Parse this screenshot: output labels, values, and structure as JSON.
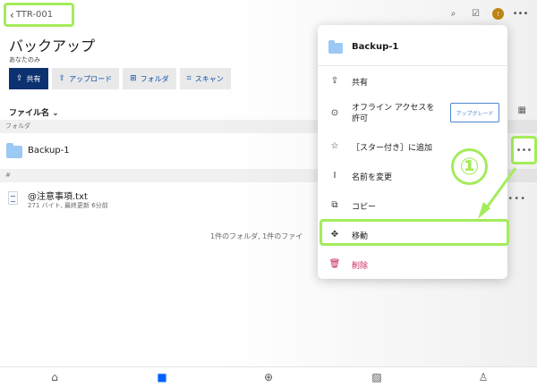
{
  "header": {
    "back_label": "TTR-001",
    "back_chevron": "‹",
    "icons": [
      "search-icon",
      "checklist-icon",
      "notification-icon",
      "more-icon"
    ]
  },
  "page": {
    "title": "バックアップ",
    "subtitle": "あなたのみ"
  },
  "actions": [
    {
      "label": "共有",
      "icon": "⇪"
    },
    {
      "label": "アップロード",
      "icon": "⇪"
    },
    {
      "label": "フォルダ",
      "icon": "⊞"
    },
    {
      "label": "スキャン",
      "icon": "⌗"
    }
  ],
  "list": {
    "sort_label": "ファイル名",
    "folder_section": "フォルダ",
    "file_section": "#",
    "folder_name": "Backup-1",
    "file_name": "@注意事項.txt",
    "file_meta": "271 バイト, 最終更新 6分前",
    "summary": "1件のフォルダ, 1件のファイ"
  },
  "context_menu": {
    "title": "Backup-1",
    "items": [
      {
        "label": "共有",
        "icon": "⇪"
      },
      {
        "label": "オフライン アクセスを許可",
        "icon": "⊙"
      },
      {
        "label": "［スター付き］に追加",
        "icon": "☆"
      },
      {
        "label": "名前を変更",
        "icon": "I"
      },
      {
        "label": "コピー",
        "icon": "⧉"
      },
      {
        "label": "移動",
        "icon": "✥"
      },
      {
        "label": "削除",
        "icon": "🗑"
      }
    ],
    "upgrade_label": "アップグレード"
  },
  "annotation": {
    "step_label": "①",
    "color": "#a3ec5a"
  },
  "tabbar": {
    "tabs": [
      "home-icon",
      "files-icon",
      "add-icon",
      "photos-icon",
      "account-icon"
    ]
  }
}
